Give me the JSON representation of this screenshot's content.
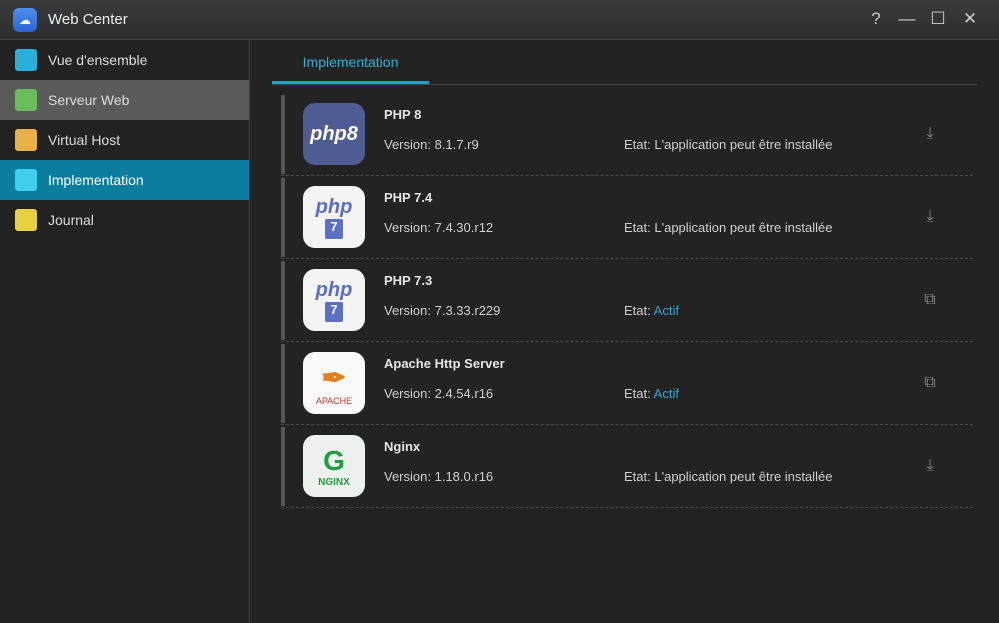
{
  "window": {
    "title": "Web Center",
    "help": "?",
    "minimize": "—",
    "maximize": "☐",
    "close": "✕"
  },
  "sidebar": {
    "items": [
      {
        "label": "Vue d'ensemble",
        "icon": "overview-icon",
        "color": "#2ab0d8"
      },
      {
        "label": "Serveur Web",
        "icon": "web-server-icon",
        "color": "#6bbd5a"
      },
      {
        "label": "Virtual Host",
        "icon": "virtual-host-icon",
        "color": "#e9b048"
      },
      {
        "label": "Implementation",
        "icon": "implementation-icon",
        "color": "#3fd0f0"
      },
      {
        "label": "Journal",
        "icon": "journal-icon",
        "color": "#e8d040"
      }
    ]
  },
  "tabs": [
    {
      "label": "Implementation"
    }
  ],
  "packages": [
    {
      "name": "PHP 8",
      "version_label": "Version:",
      "version": "8.1.7.r9",
      "state_label": "Etat:",
      "state": "L'application peut être installée",
      "active": false,
      "logo_text": "php8",
      "logo_bg": "#4f5b93",
      "logo_fg": "#fff",
      "action": "install"
    },
    {
      "name": "PHP 7.4",
      "version_label": "Version:",
      "version": "7.4.30.r12",
      "state_label": "Etat:",
      "state": "L'application peut être installée",
      "active": false,
      "logo_text": "php",
      "logo_sub": "7",
      "logo_bg": "#f4f4f4",
      "logo_fg": "#5b6fc4",
      "action": "install"
    },
    {
      "name": "PHP 7.3",
      "version_label": "Version:",
      "version": "7.3.33.r229",
      "state_label": "Etat:",
      "state": "Actif",
      "active": true,
      "logo_text": "php",
      "logo_sub": "7",
      "logo_bg": "#f4f4f4",
      "logo_fg": "#5b6fc4",
      "action": "open"
    },
    {
      "name": "Apache Http Server",
      "version_label": "Version:",
      "version": "2.4.54.r16",
      "state_label": "Etat:",
      "state": "Actif",
      "active": true,
      "logo_text": "APACHE",
      "logo_bg": "#fafafa",
      "logo_fg": "#c0392b",
      "action": "open"
    },
    {
      "name": "Nginx",
      "version_label": "Version:",
      "version": "1.18.0.r16",
      "state_label": "Etat:",
      "state": "L'application peut être installée",
      "active": false,
      "logo_text": "NGINX",
      "logo_sub": "G",
      "logo_bg": "#eef2ee",
      "logo_fg": "#1e9e3e",
      "action": "install"
    }
  ]
}
